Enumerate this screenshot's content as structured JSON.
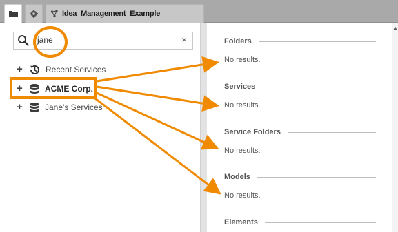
{
  "window": {
    "tabs": [
      {
        "name": "folder",
        "icon": "folder-icon"
      },
      {
        "name": "settings",
        "icon": "gear-icon"
      },
      {
        "name": "model",
        "icon": "model-icon",
        "label": "Idea_Management_Example"
      }
    ]
  },
  "search": {
    "value": "jane",
    "clear_label": "×"
  },
  "tree": {
    "items": [
      {
        "expander": "+",
        "icon": "history-icon",
        "label": "Recent Services"
      },
      {
        "expander": "+",
        "icon": "database-icon",
        "label": "ACME Corp."
      },
      {
        "expander": "+",
        "icon": "database-icon",
        "label": "Jane's Services"
      }
    ]
  },
  "results": {
    "sections": [
      {
        "title": "Folders",
        "message": "No results."
      },
      {
        "title": "Services",
        "message": "No results."
      },
      {
        "title": "Service Folders",
        "message": "No results."
      },
      {
        "title": "Models",
        "message": "No results."
      },
      {
        "title": "Elements",
        "message": ""
      }
    ]
  },
  "colors": {
    "annotation": "#f08a00",
    "tab_bar": "#a9a9a9"
  }
}
